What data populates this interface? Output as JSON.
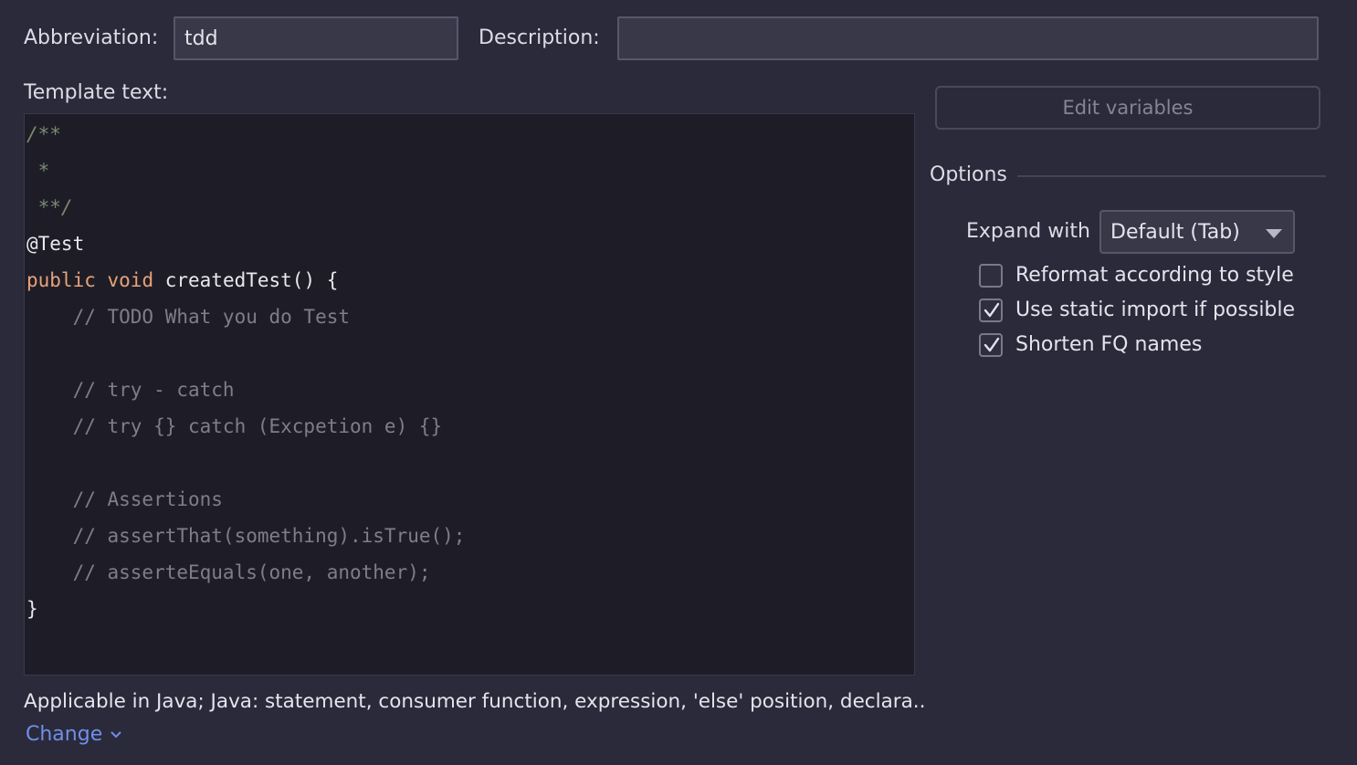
{
  "form": {
    "abbreviation_label": "Abbreviation:",
    "abbreviation_value": "tdd",
    "description_label": "Description:",
    "description_value": "",
    "template_label": "Template text:"
  },
  "code_lines": [
    {
      "segments": [
        {
          "text": "/**",
          "cls": "doc"
        }
      ]
    },
    {
      "segments": [
        {
          "text": " *",
          "cls": "doc"
        }
      ]
    },
    {
      "segments": [
        {
          "text": " **/",
          "cls": "doc"
        }
      ]
    },
    {
      "segments": [
        {
          "text": "@Test",
          "cls": "ann"
        }
      ]
    },
    {
      "segments": [
        {
          "text": "public",
          "cls": "kw"
        },
        {
          "text": " ",
          "cls": "fn"
        },
        {
          "text": "void",
          "cls": "kw"
        },
        {
          "text": " createdTest() {",
          "cls": "fn"
        }
      ]
    },
    {
      "segments": [
        {
          "text": "    // TODO What you do Test",
          "cls": "cm"
        }
      ]
    },
    {
      "segments": []
    },
    {
      "segments": [
        {
          "text": "    // try - catch",
          "cls": "cm"
        }
      ]
    },
    {
      "segments": [
        {
          "text": "    // try {} catch (Excpetion e) {}",
          "cls": "cm"
        }
      ]
    },
    {
      "segments": []
    },
    {
      "segments": [
        {
          "text": "    // Assertions",
          "cls": "cm"
        }
      ]
    },
    {
      "segments": [
        {
          "text": "    // assertThat(something).isTrue();",
          "cls": "cm"
        }
      ]
    },
    {
      "segments": [
        {
          "text": "    // asserteEquals(one, another);",
          "cls": "cm"
        }
      ]
    },
    {
      "segments": [
        {
          "text": "}",
          "cls": "fn"
        }
      ]
    }
  ],
  "edit_variables_label": "Edit variables",
  "options": {
    "title": "Options",
    "expand_with_label": "Expand with",
    "expand_with_value": "Default (Tab)",
    "checkboxes": [
      {
        "label": "Reformat according to style",
        "checked": false
      },
      {
        "label": "Use static import if possible",
        "checked": true
      },
      {
        "label": "Shorten FQ names",
        "checked": true
      }
    ]
  },
  "footer": {
    "applicable_text": "Applicable in Java; Java: statement, consumer function, expression, 'else' position, declara..",
    "change_label": "Change"
  }
}
